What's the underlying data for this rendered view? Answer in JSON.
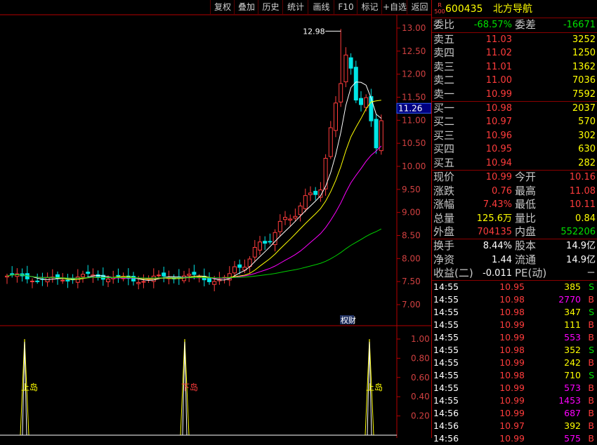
{
  "toolbar": {
    "buttons": [
      "复权",
      "叠加",
      "历史",
      "统计",
      "画线",
      "F10",
      "标记",
      "+自选",
      "返回"
    ]
  },
  "header": {
    "badge_top": "R",
    "badge_bottom": "500",
    "code": "600435",
    "name": "北方导航"
  },
  "weibi": {
    "label1": "委比",
    "value1": "-68.57%",
    "label2": "委差",
    "value2": "-16671"
  },
  "sell": [
    {
      "label": "卖五",
      "price": "11.03",
      "volume": "3252"
    },
    {
      "label": "卖四",
      "price": "11.02",
      "volume": "1250"
    },
    {
      "label": "卖三",
      "price": "11.01",
      "volume": "1362"
    },
    {
      "label": "卖二",
      "price": "11.00",
      "volume": "7036"
    },
    {
      "label": "卖一",
      "price": "10.99",
      "volume": "7592"
    }
  ],
  "buy": [
    {
      "label": "买一",
      "price": "10.98",
      "volume": "2037"
    },
    {
      "label": "买二",
      "price": "10.97",
      "volume": "570"
    },
    {
      "label": "买三",
      "price": "10.96",
      "volume": "302"
    },
    {
      "label": "买四",
      "price": "10.95",
      "volume": "630"
    },
    {
      "label": "买五",
      "price": "10.94",
      "volume": "282"
    }
  ],
  "quote": [
    {
      "l1": "现价",
      "v1": "10.99",
      "l2": "今开",
      "v2": "10.16"
    },
    {
      "l1": "涨跌",
      "v1": "0.76",
      "l2": "最高",
      "v2": "11.08"
    },
    {
      "l1": "涨幅",
      "v1": "7.43%",
      "l2": "最低",
      "v2": "10.11"
    },
    {
      "l1": "总量",
      "v1": "125.6万",
      "l2": "量比",
      "v2": "0.84"
    },
    {
      "l1": "外盘",
      "v1": "704135",
      "l2": "内盘",
      "v2": "552206"
    }
  ],
  "stats": [
    {
      "l1": "换手",
      "v1": "8.44%",
      "l2": "股本",
      "v2": "14.9亿"
    },
    {
      "l1": "净资",
      "v1": "1.44",
      "l2": "流通",
      "v2": "14.9亿"
    },
    {
      "l1": "收益(二)",
      "v1": "-0.011",
      "l2": "PE(动)",
      "v2": "－"
    }
  ],
  "ticks": [
    {
      "time": "14:55",
      "price": "10.95",
      "vol": "385",
      "side": "S"
    },
    {
      "time": "14:55",
      "price": "10.98",
      "vol": "2770",
      "side": "B"
    },
    {
      "time": "14:55",
      "price": "10.98",
      "vol": "347",
      "side": "S"
    },
    {
      "time": "14:55",
      "price": "10.99",
      "vol": "111",
      "side": "B"
    },
    {
      "time": "14:55",
      "price": "10.99",
      "vol": "553",
      "side": "B"
    },
    {
      "time": "14:55",
      "price": "10.98",
      "vol": "352",
      "side": "S"
    },
    {
      "time": "14:55",
      "price": "10.99",
      "vol": "242",
      "side": "B"
    },
    {
      "time": "14:55",
      "price": "10.98",
      "vol": "710",
      "side": "S"
    },
    {
      "time": "14:55",
      "price": "10.99",
      "vol": "573",
      "side": "B"
    },
    {
      "time": "14:55",
      "price": "10.99",
      "vol": "1453",
      "side": "B"
    },
    {
      "time": "14:56",
      "price": "10.99",
      "vol": "687",
      "side": "B"
    },
    {
      "time": "14:56",
      "price": "10.97",
      "vol": "392",
      "side": "B"
    },
    {
      "time": "14:56",
      "price": "10.99",
      "vol": "575",
      "side": "B"
    }
  ],
  "chart": {
    "price_axis": [
      "13.00",
      "12.50",
      "12.00",
      "11.50",
      "11.00",
      "10.50",
      "10.00",
      "9.50",
      "9.00",
      "8.50",
      "8.00",
      "7.50",
      "7.00"
    ],
    "current_price_tag": "11.26",
    "high_label": "12.98",
    "event_label": "权财",
    "indicator_axis": [
      "1.00",
      "0.80",
      "0.60",
      "0.40",
      "0.20"
    ],
    "signals": [
      {
        "label": "上岛",
        "value": 1.0
      },
      {
        "label": "下岛",
        "value": 1.0
      },
      {
        "label": "上岛",
        "value": 1.0
      }
    ],
    "colors": {
      "up": "#ff3c3c",
      "down": "#00e5e5",
      "ma5": "#ffffff",
      "ma10": "#ffff00",
      "ma20": "#ff00ff",
      "ma60": "#00d000",
      "signal": "#ffff00",
      "axis": "#b40000"
    }
  }
}
